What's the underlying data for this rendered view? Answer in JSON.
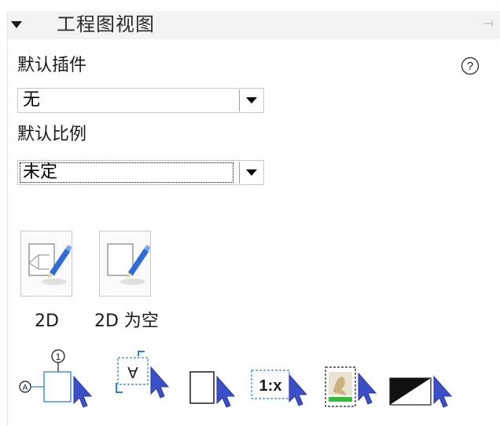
{
  "panel": {
    "title": "工程图视图",
    "default_plugin_label": "默认插件",
    "default_plugin_value": "无",
    "default_scale_label": "默认比例",
    "default_scale_value": "未定",
    "help_glyph": "?"
  },
  "tools": [
    {
      "label": "2D"
    },
    {
      "label": "2D 为空"
    }
  ],
  "bottom_icons": {
    "balloon_number": "1",
    "circle_letter": "A",
    "rotated_text": "A",
    "scale_text": "1:x"
  },
  "colors": {
    "cursor": "#3b4fc9",
    "pencil": "#2f6bd8",
    "accent_blue": "#2a7fd6",
    "header_bg": "#f3f3f3",
    "green_bar": "#2fbf3a"
  }
}
